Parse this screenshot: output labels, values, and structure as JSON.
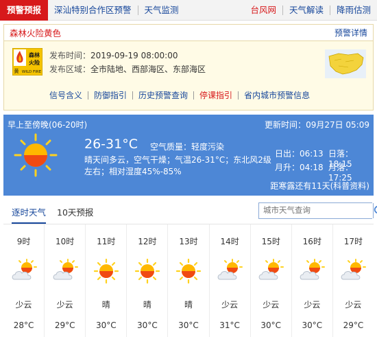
{
  "topnav": {
    "alarm_tab": "预警预报",
    "items": [
      {
        "label": "深汕特别合作区预警",
        "color": "blue"
      },
      {
        "label": "天气监测",
        "color": "blue"
      },
      {
        "label": "台风网",
        "color": "red"
      },
      {
        "label": "天气解读",
        "color": "blue"
      },
      {
        "label": "降雨估测",
        "color": "blue"
      }
    ]
  },
  "warning": {
    "title": "森林火险黄色",
    "detail_link": "预警详情",
    "sign_text_top": "森林",
    "sign_text_mid": "火险",
    "sign_text_level": "黄",
    "sign_text_en": "WILD FIRE",
    "publish_time_label": "发布时间：",
    "publish_time": "2019-09-19 08:00:00",
    "area_label": "发布区域：",
    "area": "全市陆地、西部海区、东部海区",
    "links": [
      "信号含义",
      "防御指引",
      "历史预警查询",
      "停课指引",
      "省内城市预警信息"
    ]
  },
  "today": {
    "period": "早上至傍晚(06-20时)",
    "updated_label": "更新时间：",
    "updated": "09月27日 05:09",
    "temp": "26-31°C",
    "air_quality_label": "空气质量：",
    "air_quality": "轻度污染",
    "description": "晴天间多云，空气干燥；气温26-31°C；东北风2级左右；相对湿度45%-85%",
    "sunrise_label": "日出：",
    "sunrise": "06:13",
    "sunset_label": "日落：",
    "sunset": "18:15",
    "moonrise_label": "月升：",
    "moonrise": "04:18",
    "moonset_label": "月落：",
    "moonset": "17:25",
    "dew": "距寒露还有11天(科普资料)"
  },
  "tabs": {
    "hourly": "逐时天气",
    "tenday": "10天预报"
  },
  "search": {
    "placeholder": "城市天气查询"
  },
  "hourly": [
    {
      "time": "9时",
      "weather": "少云",
      "temp": "28°C",
      "icon": "partly-cloudy-icon"
    },
    {
      "time": "10时",
      "weather": "少云",
      "temp": "29°C",
      "icon": "partly-cloudy-icon"
    },
    {
      "time": "11时",
      "weather": "晴",
      "temp": "30°C",
      "icon": "sun-icon"
    },
    {
      "time": "12时",
      "weather": "晴",
      "temp": "30°C",
      "icon": "sun-icon"
    },
    {
      "time": "13时",
      "weather": "晴",
      "temp": "30°C",
      "icon": "sun-icon"
    },
    {
      "time": "14时",
      "weather": "少云",
      "temp": "31°C",
      "icon": "partly-cloudy-icon"
    },
    {
      "time": "15时",
      "weather": "少云",
      "temp": "30°C",
      "icon": "partly-cloudy-icon"
    },
    {
      "time": "16时",
      "weather": "少云",
      "temp": "30°C",
      "icon": "partly-cloudy-icon"
    },
    {
      "time": "17时",
      "weather": "少云",
      "temp": "29°C",
      "icon": "partly-cloudy-icon"
    }
  ],
  "colors": {
    "nav_red": "#d7191b",
    "link_blue": "#17479b",
    "panel_blue": "#4d87d6",
    "warn_bg": "#fffbe6"
  }
}
